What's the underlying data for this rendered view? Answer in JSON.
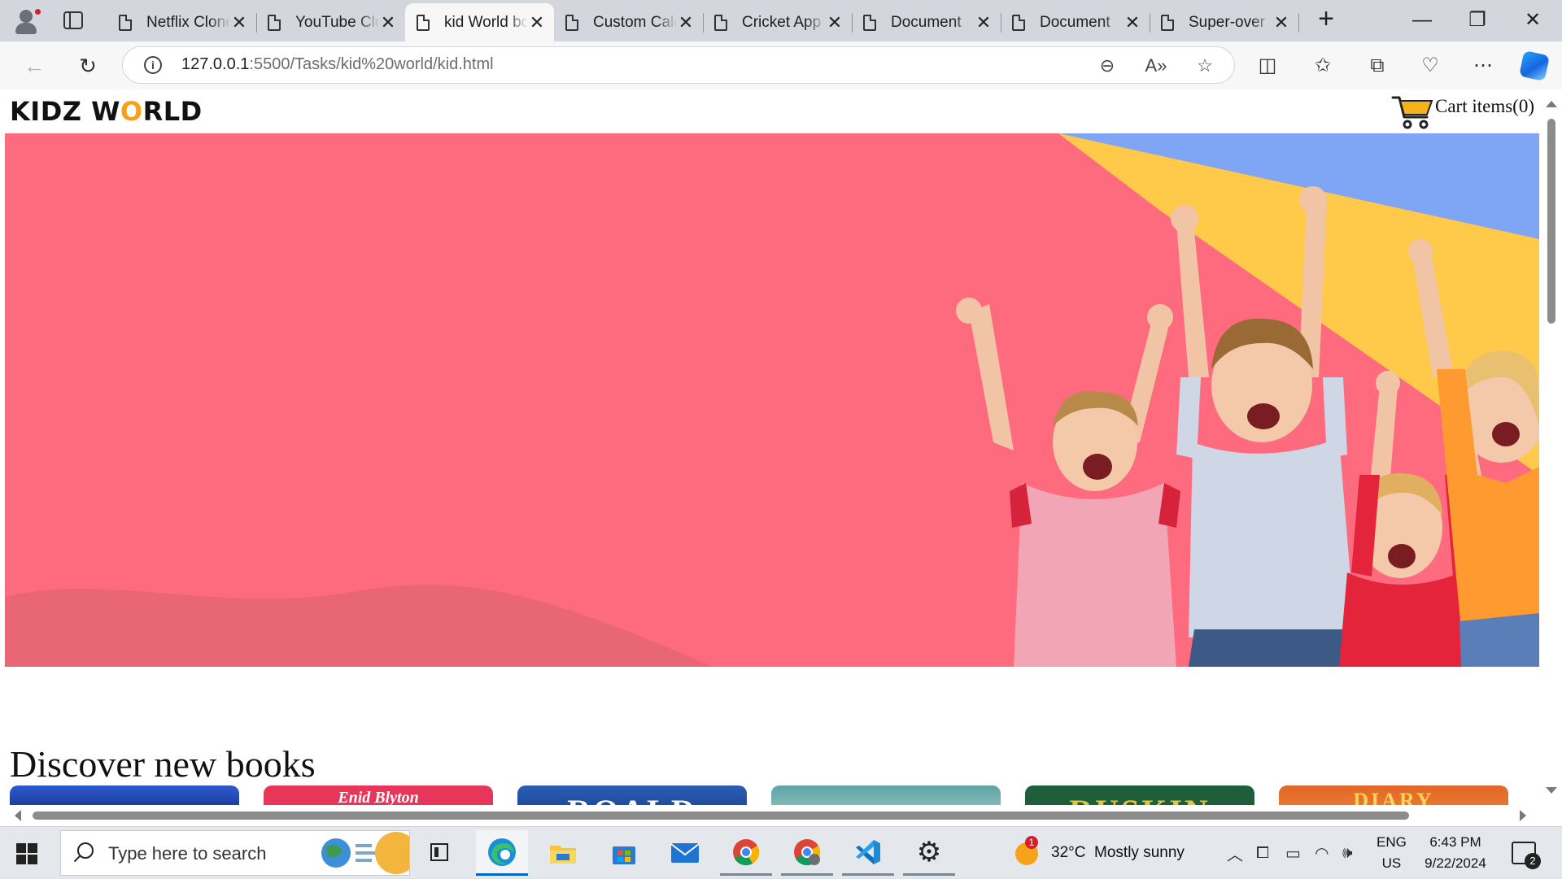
{
  "browser": {
    "tabs": [
      {
        "label": "Netflix Clone",
        "active": false
      },
      {
        "label": "YouTube Clone",
        "active": false
      },
      {
        "label": "kid World books",
        "active": true
      },
      {
        "label": "Custom Calendar",
        "active": false
      },
      {
        "label": "Cricket App",
        "active": false
      },
      {
        "label": "Document",
        "active": false
      },
      {
        "label": "Document",
        "active": false
      },
      {
        "label": "Super-over",
        "active": false
      }
    ],
    "url_host": "127.0.0.1",
    "url_path": ":5500/Tasks/kid%20world/kid.html",
    "window_controls": {
      "minimize": "—",
      "restore": "❐",
      "close": "✕"
    }
  },
  "site": {
    "logo_before": "KIDZ W",
    "logo_o": "O",
    "logo_after": "RLD",
    "cart_label": "Cart items(0)",
    "section_title": "Discover new books",
    "books": [
      {
        "text": "",
        "color": "#1b3a8a"
      },
      {
        "text": "Enid Blyton",
        "color": "#e8365a"
      },
      {
        "text": "ROALD",
        "color": "#1f4a9c"
      },
      {
        "text": "",
        "color": "#7fb6b3"
      },
      {
        "text": "RUSKIN",
        "color": "#1f5e3a"
      },
      {
        "text": "DIARY",
        "color": "#e2662a"
      }
    ],
    "colors": {
      "hero_pink": "#ff6b7e",
      "hero_yellow": "#ffc94a",
      "hero_blue": "#7ea6f5",
      "logo_accent": "#f6a11a"
    }
  },
  "taskbar": {
    "search_placeholder": "Type here to search",
    "weather_temp": "32°C",
    "weather_text": "Mostly sunny",
    "weather_badge": "1",
    "lang_top": "ENG",
    "lang_bottom": "US",
    "time": "6:43 PM",
    "date": "9/22/2024",
    "notification_count": "2",
    "apps": [
      "task-view",
      "edge",
      "file-explorer",
      "microsoft-store",
      "mail",
      "chrome",
      "chrome-profile",
      "vs-code",
      "settings"
    ]
  }
}
